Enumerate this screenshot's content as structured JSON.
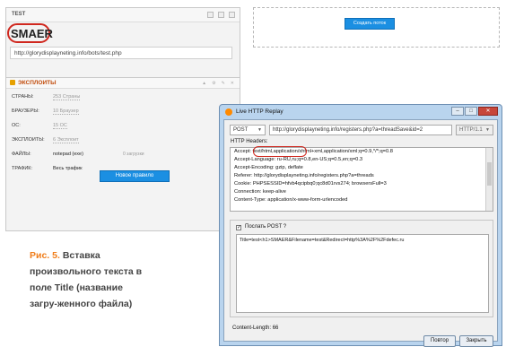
{
  "panel": {
    "title": "TEST",
    "brand": "SMAER",
    "url": "http://glorydisplayneting.info/bots/test.php"
  },
  "exploits": {
    "title": "ЭКСПЛОИТЫ",
    "rows": [
      {
        "label": "СТРАНЫ:",
        "value": "253 Страны",
        "extra": ""
      },
      {
        "label": "БРАУЗЕРЫ:",
        "value": "10 Браузер",
        "extra": ""
      },
      {
        "label": "ОС:",
        "value": "15 ОС",
        "extra": ""
      },
      {
        "label": "ЭКСПЛОИТЫ:",
        "value": "6 Эксплоит",
        "extra": ""
      },
      {
        "label": "ФАЙЛЫ:",
        "value": "notepad (exe)",
        "extra": "0 загрузки"
      },
      {
        "label": "ТРАФИК:",
        "value": "Весь трафик",
        "extra": ""
      }
    ],
    "new_rule_button": "Новое правило"
  },
  "right_area": {
    "create_stream_button": "Создать поток"
  },
  "caption": {
    "fig": "Рис. 5.",
    "text": "Вставка произвольного текста в поле Title (название загру-женного файла)"
  },
  "replay_window": {
    "title": "Live HTTP Replay",
    "method": "POST",
    "url": "http://glorydisplayneting.info/registers.php?a=threadSave&id=2",
    "protocol": "HTTP/1.1",
    "headers_label": "HTTP Headers:",
    "headers": [
      "Accept: text/html,application/xhtml+xml,application/xml;q=0.9,*/*;q=0.8",
      "Accept-Language: ru-RU,ru;q=0.8,en-US;q=0.5,en;q=0.3",
      "Accept-Encoding: gzip, deflate",
      "Referer: http://glorydisplayneting.info/registers.php?a=threads",
      "Cookie: PHPSESSID=hfvb4qcipbq0;qc8d01rvs274; browsersFull=3",
      "Connection: keep-alive",
      "Content-Type: application/x-www-form-urlencoded"
    ],
    "post_label": "Послать POST ?",
    "post_body": "Title=test<h1>SMAER&Filename=test&Redirect=http%3A%2F%2Fdefec.ru",
    "content_length": "Content-Length:   66",
    "repeat_button": "Повтор",
    "close_button": "Закрыть"
  }
}
